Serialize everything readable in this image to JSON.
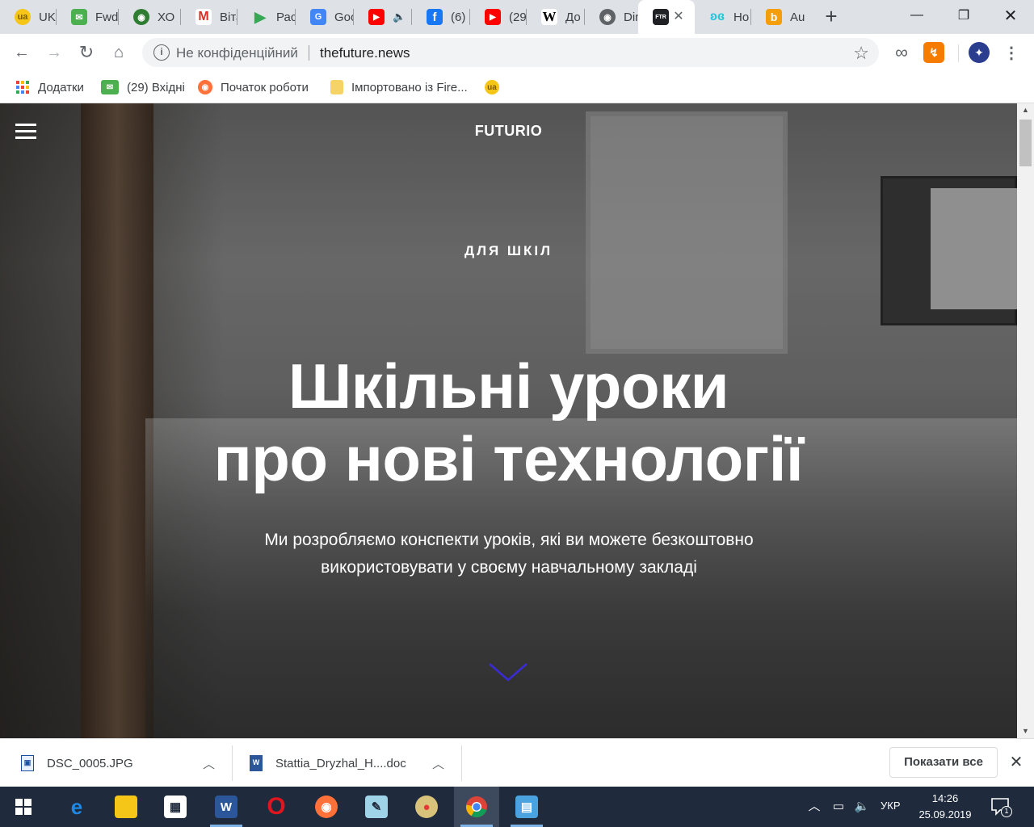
{
  "browser": {
    "tabs": [
      {
        "label": "UKI",
        "icon": "ukr-net-icon",
        "color": "#f5c518"
      },
      {
        "label": "Fwd",
        "icon": "mail-envelope-icon",
        "color": "#4caf50"
      },
      {
        "label": "ХО",
        "icon": "globe-icon",
        "color": "#2e7d32"
      },
      {
        "label": "Віта",
        "icon": "gmail-icon",
        "color": "#d93025"
      },
      {
        "label": "Рас",
        "icon": "google-play-icon",
        "color": "#34a853"
      },
      {
        "label": "Goo",
        "icon": "google-translate-icon",
        "color": "#4285f4"
      },
      {
        "label": "",
        "icon": "youtube-icon",
        "color": "#ff0000"
      },
      {
        "label": "(6)",
        "icon": "facebook-icon",
        "color": "#1877f2"
      },
      {
        "label": "(29",
        "icon": "youtube-icon",
        "color": "#ff0000"
      },
      {
        "label": "До",
        "icon": "wikipedia-icon",
        "color": "#ffffff"
      },
      {
        "label": "Din",
        "icon": "globe-icon",
        "color": "#5f6368"
      },
      {
        "label": "",
        "icon": "futurio-ftr-icon",
        "color": "#202124",
        "active": true
      },
      {
        "label": "Но",
        "icon": "butterfly-icon",
        "color": "#26c6da"
      },
      {
        "label": "Au",
        "icon": "b-logo-icon",
        "color": "#f59e0b"
      }
    ],
    "active_tab_badge": "FTR",
    "wiki_badge": "W",
    "fb_badge": "f",
    "b_badge": "b",
    "omnibox": {
      "security_label": "Не конфіденційний",
      "url": "thefuture.news"
    },
    "bookmarks": [
      {
        "label": "Додатки",
        "icon": "apps-grid-icon"
      },
      {
        "label": "(29) Вхідні",
        "icon": "mail-envelope-icon"
      },
      {
        "label": "Початок роботи",
        "icon": "firefox-icon"
      },
      {
        "label": "Імпортовано із Fire...",
        "icon": "folder-icon"
      },
      {
        "label": "",
        "icon": "ukr-net-icon"
      }
    ]
  },
  "page": {
    "logo": "FUTURIO",
    "eyebrow": "ДЛЯ ШКІЛ",
    "title_line1": "Шкільні уроки",
    "title_line2": "про нові технології",
    "subtitle": "Ми розробляємо конспекти уроків, які ви можете безкоштовно використовувати у своєму навчальному закладі",
    "accent_color": "#3b2bd6"
  },
  "downloads": {
    "items": [
      {
        "filename": "DSC_0005.JPG",
        "icon": "image-file-icon"
      },
      {
        "filename": "Stattia_Dryzhal_H....doc",
        "icon": "word-file-icon"
      }
    ],
    "show_all_label": "Показати все",
    "word_badge": "W",
    "img_badge": "▣"
  },
  "taskbar": {
    "apps": [
      {
        "name": "edge",
        "icon": "edge-icon",
        "color": "#1e88e5"
      },
      {
        "name": "file-explorer",
        "icon": "folder-icon",
        "color": "#f5c518"
      },
      {
        "name": "store",
        "icon": "store-icon",
        "color": "#ffffff"
      },
      {
        "name": "word",
        "icon": "word-icon",
        "color": "#2b579a"
      },
      {
        "name": "opera",
        "icon": "opera-icon",
        "color": "#e0161e"
      },
      {
        "name": "firefox",
        "icon": "firefox-icon",
        "color": "#ff7139"
      },
      {
        "name": "pad",
        "icon": "notepad-icon",
        "color": "#9fd3e8"
      },
      {
        "name": "paint",
        "icon": "paint-palette-icon",
        "color": "#d9c27a"
      },
      {
        "name": "chrome",
        "icon": "chrome-icon",
        "color": "#4285f4",
        "active": true
      },
      {
        "name": "control-panel",
        "icon": "control-panel-icon",
        "color": "#4aa3df"
      }
    ],
    "word_badge": "W",
    "lang": "УКР",
    "time": "14:26",
    "date": "25.09.2019",
    "notifications": "1"
  }
}
